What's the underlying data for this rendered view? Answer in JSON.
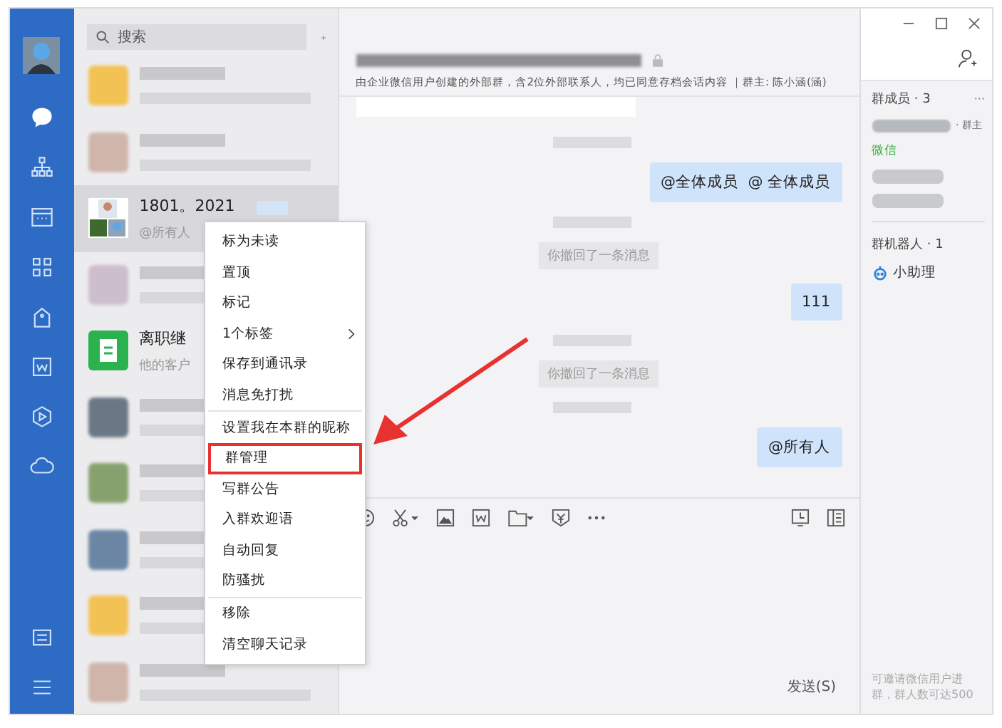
{
  "search": {
    "placeholder": "搜索"
  },
  "chats": [
    {
      "kind": "blurred"
    },
    {
      "kind": "blurred"
    },
    {
      "kind": "group",
      "name": "1801。2021",
      "preview": "@所有人",
      "selected": true
    },
    {
      "kind": "blurred"
    },
    {
      "kind": "app",
      "name": "离职继",
      "preview": "他的客户",
      "selected": false
    },
    {
      "kind": "blurred"
    },
    {
      "kind": "blurred"
    },
    {
      "kind": "blurred"
    },
    {
      "kind": "blurred"
    },
    {
      "kind": "blurred"
    }
  ],
  "context_menu": [
    {
      "label": "标为未读",
      "separator_before": false,
      "submenu": false,
      "highlighted": false
    },
    {
      "label": "置顶",
      "separator_before": false,
      "submenu": false,
      "highlighted": false
    },
    {
      "label": "标记",
      "separator_before": false,
      "submenu": false,
      "highlighted": false
    },
    {
      "label": "1个标签",
      "separator_before": false,
      "submenu": true,
      "highlighted": false
    },
    {
      "label": "保存到通讯录",
      "separator_before": false,
      "submenu": false,
      "highlighted": false
    },
    {
      "label": "消息免打扰",
      "separator_before": false,
      "submenu": false,
      "highlighted": false
    },
    {
      "label": "设置我在本群的昵称",
      "separator_before": true,
      "submenu": false,
      "highlighted": false
    },
    {
      "label": "群管理",
      "separator_before": false,
      "submenu": false,
      "highlighted": true
    },
    {
      "label": "写群公告",
      "separator_before": false,
      "submenu": false,
      "highlighted": false
    },
    {
      "label": "入群欢迎语",
      "separator_before": false,
      "submenu": false,
      "highlighted": false
    },
    {
      "label": "自动回复",
      "separator_before": false,
      "submenu": false,
      "highlighted": false
    },
    {
      "label": "防骚扰",
      "separator_before": false,
      "submenu": false,
      "highlighted": false
    },
    {
      "label": "移除",
      "separator_before": true,
      "submenu": false,
      "highlighted": false
    },
    {
      "label": "清空聊天记录",
      "separator_before": false,
      "submenu": false,
      "highlighted": false
    }
  ],
  "chat_header": {
    "subtitle": "由企业微信用户创建的外部群，含2位外部联系人，均已同意存档会话内容 ｜群主: 陈小涵(涵)"
  },
  "messages": [
    {
      "kind": "card"
    },
    {
      "kind": "blurred"
    },
    {
      "kind": "sent",
      "text": "@全体成员  @ 全体成员"
    },
    {
      "kind": "blurred"
    },
    {
      "kind": "notice",
      "text": "你撤回了一条消息"
    },
    {
      "kind": "sent",
      "text": "111"
    },
    {
      "kind": "blurred"
    },
    {
      "kind": "notice",
      "text": "你撤回了一条消息"
    },
    {
      "kind": "blurred"
    },
    {
      "kind": "sent",
      "text": "@所有人"
    }
  ],
  "send_button": "发送(S)",
  "members_panel": {
    "members_title": "群成员 · 3",
    "more": "···",
    "owner_tag": "· 群主",
    "wechat_label": "微信",
    "robots_title": "群机器人 · 1",
    "robot_name": "小助理",
    "footer": "可邀请微信用户进群，群人数可达500"
  }
}
